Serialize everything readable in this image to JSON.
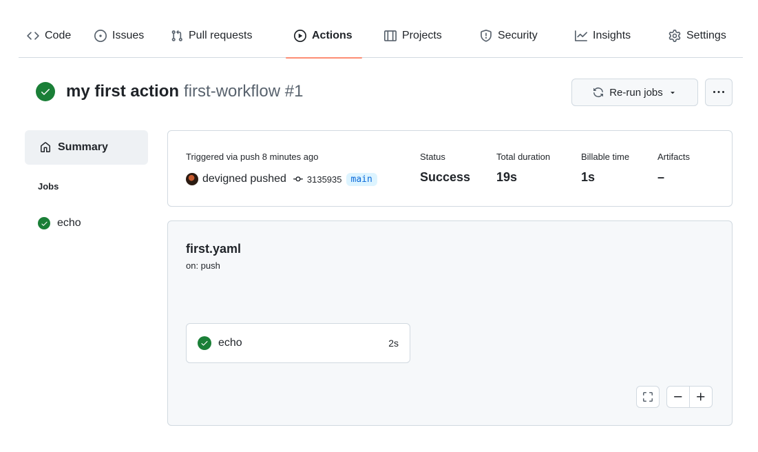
{
  "nav": {
    "tabs": [
      {
        "label": "Code",
        "icon": "code-icon"
      },
      {
        "label": "Issues",
        "icon": "issue-opened-icon"
      },
      {
        "label": "Pull requests",
        "icon": "git-pull-request-icon"
      },
      {
        "label": "Actions",
        "icon": "play-icon",
        "active": true
      },
      {
        "label": "Projects",
        "icon": "table-icon"
      },
      {
        "label": "Security",
        "icon": "shield-icon"
      },
      {
        "label": "Insights",
        "icon": "graph-icon"
      },
      {
        "label": "Settings",
        "icon": "gear-icon"
      }
    ],
    "active_underline_color": "#fd8c73"
  },
  "run": {
    "status": "success",
    "status_color": "#1a7f37",
    "workflow_name": "my first action",
    "run_label": "first-workflow #1",
    "rerun_label": "Re-run jobs"
  },
  "sidebar": {
    "summary_label": "Summary",
    "jobs_heading": "Jobs",
    "jobs": [
      {
        "name": "echo",
        "status": "success"
      }
    ]
  },
  "summary": {
    "trigger_text": "Triggered via push 8 minutes ago",
    "actor_text": "devigned pushed",
    "commit_sha": "3135935",
    "branch": "main",
    "status_label": "Status",
    "status_value": "Success",
    "duration_label": "Total duration",
    "duration_value": "19s",
    "billable_label": "Billable time",
    "billable_value": "1s",
    "artifacts_label": "Artifacts",
    "artifacts_value": "–"
  },
  "graph": {
    "file_name": "first.yaml",
    "trigger": "on: push",
    "jobs": [
      {
        "name": "echo",
        "duration": "2s",
        "status": "success"
      }
    ]
  }
}
